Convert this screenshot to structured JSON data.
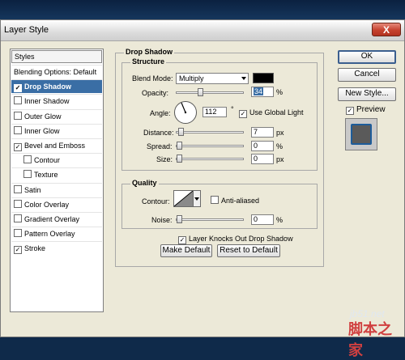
{
  "window": {
    "title": "Layer Style",
    "close": "X"
  },
  "styles_panel": {
    "header": "Styles",
    "items": [
      {
        "label": "Blending Options: Default",
        "checkbox": false,
        "checked": false,
        "selected": false,
        "indent": false
      },
      {
        "label": "Drop Shadow",
        "checkbox": true,
        "checked": true,
        "selected": true,
        "indent": false
      },
      {
        "label": "Inner Shadow",
        "checkbox": true,
        "checked": false,
        "selected": false,
        "indent": false
      },
      {
        "label": "Outer Glow",
        "checkbox": true,
        "checked": false,
        "selected": false,
        "indent": false
      },
      {
        "label": "Inner Glow",
        "checkbox": true,
        "checked": false,
        "selected": false,
        "indent": false
      },
      {
        "label": "Bevel and Emboss",
        "checkbox": true,
        "checked": true,
        "selected": false,
        "indent": false
      },
      {
        "label": "Contour",
        "checkbox": true,
        "checked": false,
        "selected": false,
        "indent": true
      },
      {
        "label": "Texture",
        "checkbox": true,
        "checked": false,
        "selected": false,
        "indent": true
      },
      {
        "label": "Satin",
        "checkbox": true,
        "checked": false,
        "selected": false,
        "indent": false
      },
      {
        "label": "Color Overlay",
        "checkbox": true,
        "checked": false,
        "selected": false,
        "indent": false
      },
      {
        "label": "Gradient Overlay",
        "checkbox": true,
        "checked": false,
        "selected": false,
        "indent": false
      },
      {
        "label": "Pattern Overlay",
        "checkbox": true,
        "checked": false,
        "selected": false,
        "indent": false
      },
      {
        "label": "Stroke",
        "checkbox": true,
        "checked": true,
        "selected": false,
        "indent": false
      }
    ]
  },
  "drop_shadow": {
    "title": "Drop Shadow",
    "structure": {
      "title": "Structure",
      "blend_mode": {
        "label": "Blend Mode:",
        "value": "Multiply",
        "color": "#000000"
      },
      "opacity": {
        "label": "Opacity:",
        "value": "34",
        "unit": "%",
        "slider_fraction": 0.34
      },
      "angle": {
        "label": "Angle:",
        "value": "112",
        "unit": "°",
        "global_light_label": "Use Global Light",
        "global_light_checked": true
      },
      "distance": {
        "label": "Distance:",
        "value": "7",
        "unit": "px",
        "slider_fraction": 0.02
      },
      "spread": {
        "label": "Spread:",
        "value": "0",
        "unit": "%",
        "slider_fraction": 0.0
      },
      "size": {
        "label": "Size:",
        "value": "0",
        "unit": "px",
        "slider_fraction": 0.0
      }
    },
    "quality": {
      "title": "Quality",
      "contour_label": "Contour:",
      "anti_aliased_label": "Anti-aliased",
      "anti_aliased_checked": false,
      "noise": {
        "label": "Noise:",
        "value": "0",
        "unit": "%",
        "slider_fraction": 0.0
      }
    },
    "knockout": {
      "label": "Layer Knocks Out Drop Shadow",
      "checked": true
    },
    "make_default": "Make Default",
    "reset_default": "Reset to Default"
  },
  "buttons": {
    "ok": "OK",
    "cancel": "Cancel",
    "new_style": "New Style...",
    "preview_label": "Preview",
    "preview_checked": true
  },
  "watermark": {
    "site": "jb51.net",
    "text": "脚本之家"
  },
  "colors": {
    "selection": "#3a6ea5",
    "dialog_bg": "#ece9d8",
    "preview_stroke": "#1e5c9a"
  }
}
